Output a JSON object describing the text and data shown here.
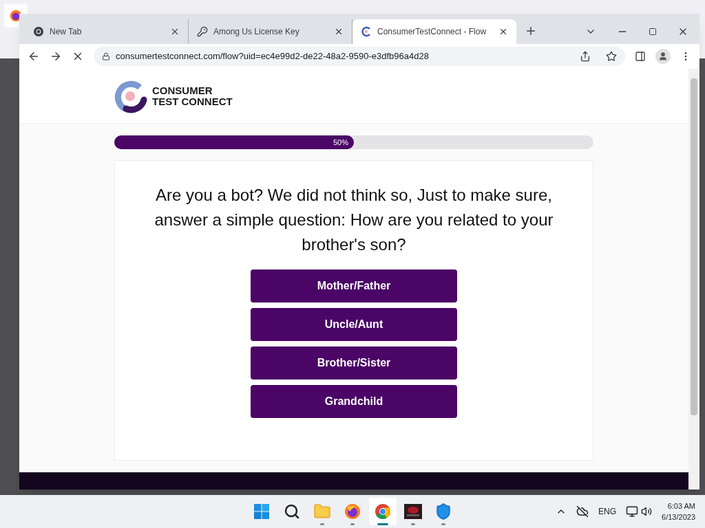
{
  "browser": {
    "tabs": [
      {
        "title": "New Tab",
        "selected": false,
        "kind": "chrome"
      },
      {
        "title": "Among Us License Key",
        "selected": false,
        "kind": "key"
      },
      {
        "title": "ConsumerTestConnect - Flow",
        "selected": true,
        "kind": "site"
      }
    ],
    "url": "consumertestconnect.com/flow?uid=ec4e99d2-de22-48a2-9590-e3dfb96a4d28"
  },
  "page": {
    "logo": {
      "line_1": "CONSUMER",
      "line_2": "TEST CONNECT"
    },
    "progress": {
      "level": 0.5,
      "label": "50%"
    },
    "question": "Are you a bot? We did not think so, Just to make sure, answer a simple question: How are you related to your brother's son?",
    "answers": [
      "Mother/Father",
      "Uncle/Aunt",
      "Brother/Sister",
      "Grandchild"
    ]
  },
  "taskbar": {
    "apps": [
      {
        "kind": "start",
        "active": false
      },
      {
        "kind": "search",
        "active": false
      },
      {
        "kind": "files",
        "active": false
      },
      {
        "kind": "firefox",
        "active": false
      },
      {
        "kind": "chrome",
        "active": true
      },
      {
        "kind": "game",
        "active": false
      },
      {
        "kind": "shield",
        "active": false
      }
    ],
    "language": "ENG",
    "time": "6:03 AM",
    "date": "6/13/2023"
  }
}
